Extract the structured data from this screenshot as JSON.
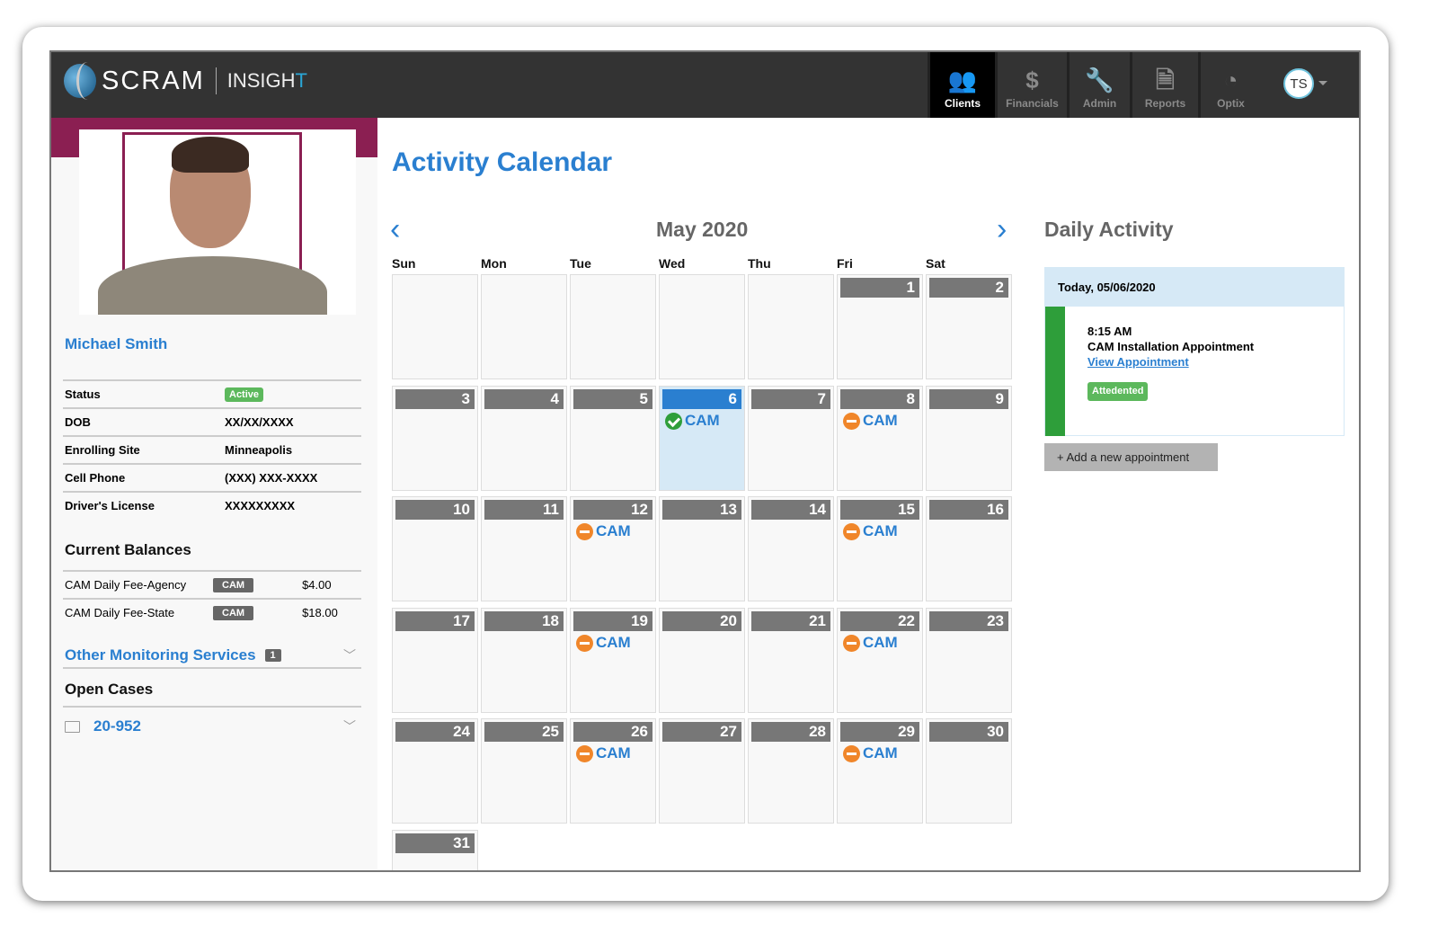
{
  "header": {
    "logo_primary": "SCRAM",
    "logo_secondary": "INSIGHT",
    "nav": [
      {
        "label": "Clients",
        "icon": "users-icon",
        "active": true
      },
      {
        "label": "Financials",
        "icon": "dollar-icon"
      },
      {
        "label": "Admin",
        "icon": "wrench-icon"
      },
      {
        "label": "Reports",
        "icon": "document-icon"
      },
      {
        "label": "Optix",
        "icon": "gauge-icon"
      }
    ],
    "user_initials": "TS"
  },
  "client": {
    "name": "Michael Smith",
    "info": [
      {
        "label": "Status",
        "value": "Active"
      },
      {
        "label": "DOB",
        "value": "XX/XX/XXXX"
      },
      {
        "label": "Enrolling Site",
        "value": "Minneapolis"
      },
      {
        "label": "Cell Phone",
        "value": "(XXX) XXX-XXXX"
      },
      {
        "label": "Driver's License",
        "value": "XXXXXXXXX"
      }
    ],
    "balances_title": "Current Balances",
    "balances": [
      {
        "label": "CAM Daily Fee-Agency",
        "tag": "CAM",
        "amount": "$4.00"
      },
      {
        "label": "CAM Daily Fee-State",
        "tag": "CAM",
        "amount": "$18.00"
      }
    ],
    "other_services": {
      "label": "Other Monitoring Services",
      "count": "1"
    },
    "open_cases_title": "Open Cases",
    "cases": [
      "20-952"
    ]
  },
  "calendar": {
    "title": "Activity Calendar",
    "month": "May 2020",
    "weekdays": [
      "Sun",
      "Mon",
      "Tue",
      "Wed",
      "Thu",
      "Fri",
      "Sat"
    ],
    "first_weekday": 5,
    "days": 31,
    "today": 6,
    "events": [
      {
        "day": 6,
        "label": "CAM",
        "status": "attended"
      },
      {
        "day": 8,
        "label": "CAM",
        "status": "pending"
      },
      {
        "day": 12,
        "label": "CAM",
        "status": "pending"
      },
      {
        "day": 15,
        "label": "CAM",
        "status": "pending"
      },
      {
        "day": 19,
        "label": "CAM",
        "status": "pending"
      },
      {
        "day": 22,
        "label": "CAM",
        "status": "pending"
      },
      {
        "day": 26,
        "label": "CAM",
        "status": "pending"
      },
      {
        "day": 29,
        "label": "CAM",
        "status": "pending"
      }
    ]
  },
  "daily": {
    "title": "Daily Activity",
    "date": "Today, 05/06/2020",
    "time": "8:15 AM",
    "appointment": "CAM Installation Appointment",
    "link": "View Appointment",
    "status": "Attedented",
    "add_label": "+ Add a new appointment"
  },
  "colors": {
    "accent": "#2a7fd0",
    "brand": "#8b1f52",
    "attended": "#2e9e3a",
    "pending": "#f0862a",
    "header": "#333333"
  }
}
